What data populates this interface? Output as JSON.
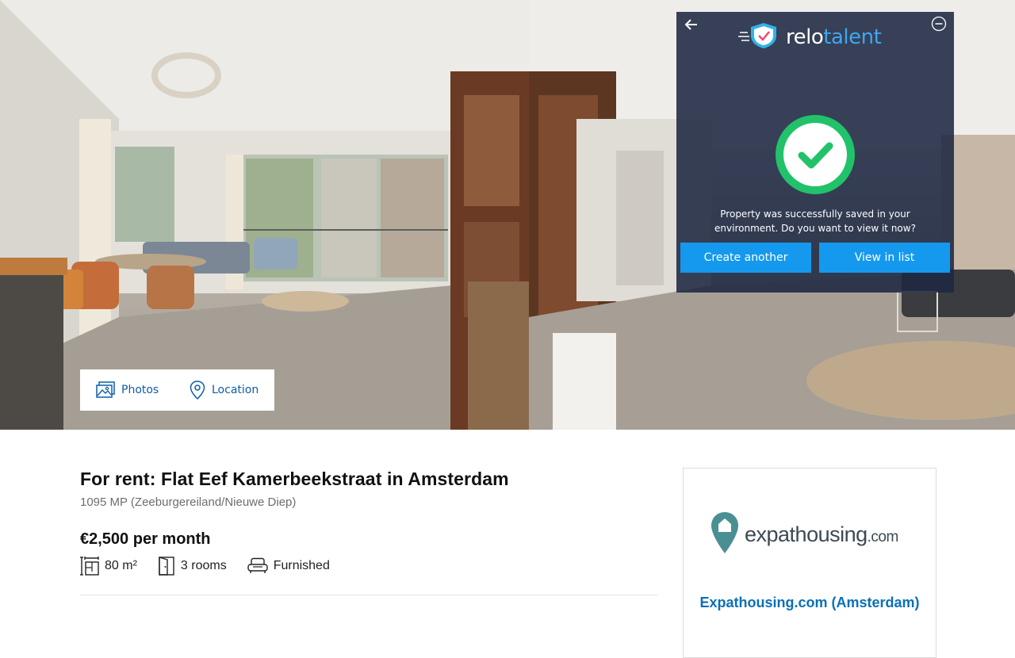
{
  "gallery": {
    "tabs": [
      {
        "label": "Photos",
        "icon": "photos-icon"
      },
      {
        "label": "Location",
        "icon": "location-pin-icon"
      }
    ]
  },
  "relotalent": {
    "brand_part1": "relo",
    "brand_part2": "talent",
    "message": "Property was successfully saved in your environment. Do you want to view it now?",
    "create_label": "Create another",
    "view_label": "View in list",
    "accent_color": "#1499ee",
    "success_color": "#22c26a"
  },
  "listing": {
    "title": "For rent: Flat Eef Kamerbeekstraat in Amsterdam",
    "address": "1095 MP (Zeeburgereiland/Nieuwe Diep)",
    "price": "€2,500 per month",
    "features": [
      {
        "icon": "floor-area-icon",
        "label": "80 m²"
      },
      {
        "icon": "rooms-door-icon",
        "label": "3 rooms"
      },
      {
        "icon": "sofa-icon",
        "label": "Furnished"
      }
    ]
  },
  "agent": {
    "logo_main": "expathousing",
    "logo_suffix": ".com",
    "name": "Expathousing.com (Amsterdam)",
    "logo_color": "#4a8f93"
  }
}
